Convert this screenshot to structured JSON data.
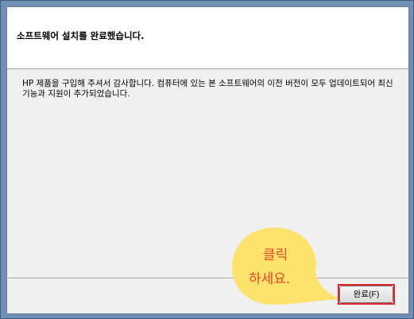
{
  "dialog": {
    "heading": "소프트웨어 설치를 완료했습니다.",
    "body_text": "HP 제품을 구입해 주셔서 감사합니다. 컴퓨터에 있는 본 소프트웨어의 이전 버전이 모두 업데이트되어 최신 기능과 지원이 추가되었습니다.",
    "finish_button_label": "완료(F)"
  },
  "annotation": {
    "line1": "클릭",
    "line2": "하세요.",
    "bubble_color": "#fde36b",
    "text_color": "#e2462a",
    "highlight_color": "#e8222d"
  }
}
